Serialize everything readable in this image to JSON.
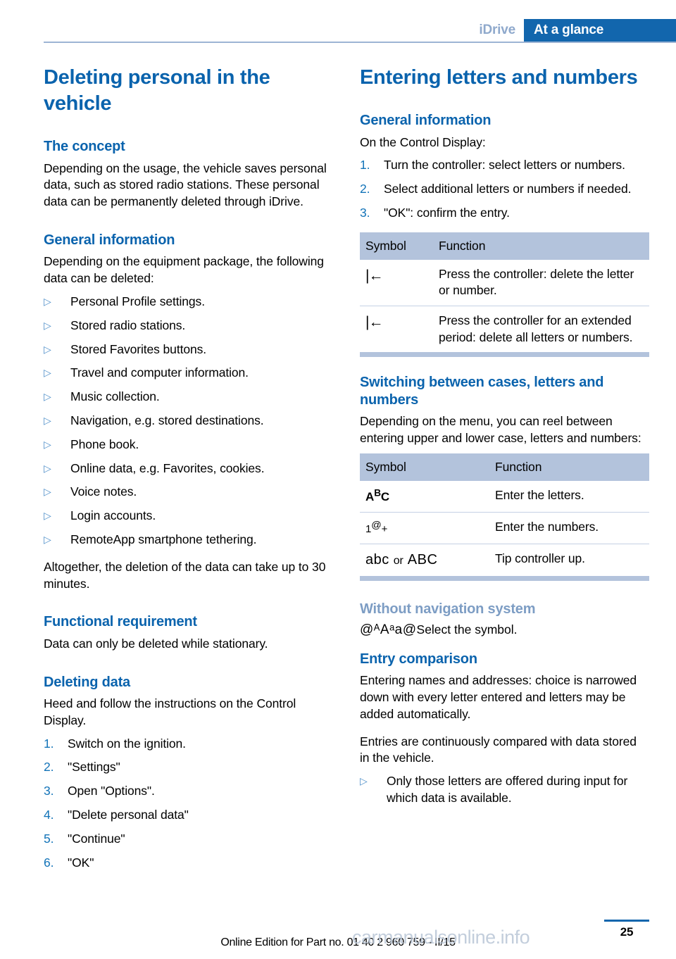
{
  "header": {
    "tab_inactive": "iDrive",
    "tab_active": "At a glance"
  },
  "colors": {
    "accent_blue": "#0a63ad",
    "tab_blue": "#1266ad",
    "light_blue_heading": "#7d9dc4",
    "table_header_band": "#b3c3dc",
    "bullet_blue": "#4f8fc9"
  },
  "left_column": {
    "title": "Deleting personal in the vehicle",
    "concept_heading": "The concept",
    "concept_body": "Depending on the usage, the vehicle saves personal data, such as stored radio stations. These personal data can be permanently deleted through iDrive.",
    "general_heading": "General information",
    "general_intro": "Depending on the equipment package, the following data can be deleted:",
    "deletable_items": [
      "Personal Profile settings.",
      "Stored radio stations.",
      "Stored Favorites buttons.",
      "Travel and computer information.",
      "Music collection.",
      "Navigation, e.g. stored destinations.",
      "Phone book.",
      "Online data, e.g. Favorites, cookies.",
      "Voice notes.",
      "Login accounts.",
      "RemoteApp smartphone tethering."
    ],
    "duration_note": "Altogether, the deletion of the data can take up to 30 minutes.",
    "functional_heading": "Functional requirement",
    "functional_body": "Data can only be deleted while stationary.",
    "deleting_heading": "Deleting data",
    "deleting_body": "Heed and follow the instructions on the Control Display.",
    "deleting_steps": [
      "Switch on the ignition.",
      "\"Settings\"",
      "Open \"Options\".",
      "\"Delete personal data\"",
      "\"Continue\"",
      "\"OK\""
    ]
  },
  "right_column": {
    "title": "Entering letters and numbers",
    "general_heading": "General information",
    "general_intro": "On the Control Display:",
    "general_steps": [
      "Turn the controller: select letters or numbers.",
      "Select additional letters or numbers if needed.",
      "\"OK\": confirm the entry."
    ],
    "table_delete": {
      "headers": [
        "Symbol",
        "Function"
      ],
      "rows": [
        {
          "symbol": "|←",
          "symbol_name": "backspace-icon",
          "function": "Press the controller: delete the letter or number."
        },
        {
          "symbol": "|←",
          "symbol_name": "backspace-long-icon",
          "function": "Press the controller for an extended period: delete all letters or numbers."
        }
      ]
    },
    "switching_heading": "Switching between cases, letters and numbers",
    "switching_body": "Depending on the menu, you can reel between entering upper and lower case, letters and numbers:",
    "table_switching": {
      "headers": [
        "Symbol",
        "Function"
      ],
      "rows": [
        {
          "symbol": "AᴮC",
          "symbol_name": "letters-mode-icon",
          "function": "Enter the letters."
        },
        {
          "symbol": "1@+",
          "symbol_name": "numbers-mode-icon",
          "function": "Enter the numbers."
        },
        {
          "symbol": "abc or ABC",
          "symbol_name": "case-toggle-icon",
          "symbol_or": "or",
          "symbol_a": "abc",
          "symbol_b": "ABC",
          "function": "Tip controller up."
        }
      ]
    },
    "without_nav_heading": "Without navigation system",
    "without_nav_symbols": [
      "@ᴬ",
      "Aᵃ",
      "a@"
    ],
    "without_nav_text": "Select the symbol.",
    "entry_comparison_heading": "Entry comparison",
    "entry_comparison_p1": "Entering names and addresses: choice is narrowed down with every letter entered and letters may be added automatically.",
    "entry_comparison_p2": "Entries are continuously compared with data stored in the vehicle.",
    "entry_comparison_bullets": [
      "Only those letters are offered during input for which data is available."
    ]
  },
  "footer": {
    "page_number": "25",
    "note": "Online Edition for Part no. 01 40 2 960 759 - II/15",
    "watermark": "carmanualsonline.info"
  }
}
